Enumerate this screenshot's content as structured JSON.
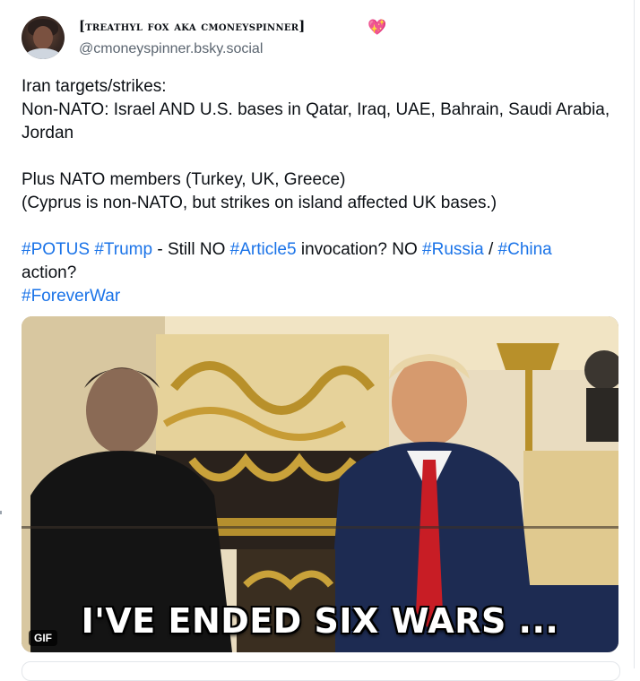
{
  "author": {
    "display_name": "[treathyl fox aka cmoneyspinner]",
    "badge_icon": "sparkling-heart-icon",
    "handle": "@cmoneyspinner.bsky.social"
  },
  "post": {
    "line1": "Iran targets/strikes:",
    "line2": "Non-NATO: Israel AND U.S. bases in Qatar, Iraq, UAE, Bahrain, Saudi Arabia, Jordan",
    "line3": "Plus NATO members (Turkey, UK, Greece)",
    "line4": "(Cyprus is non-NATO, but strikes on island affected UK bases.)",
    "tags": {
      "potus": "#POTUS",
      "trump": "#Trump",
      "article5": "#Article5",
      "russia": "#Russia",
      "china": "#China",
      "foreverwar": "#ForeverWar"
    },
    "segments": {
      "dash": " - Still NO ",
      "invocation": " invocation? NO ",
      "slash": " / ",
      "action": " action?"
    }
  },
  "media": {
    "badge": "GIF",
    "caption": "I'VE ENDED SIX WARS ..."
  },
  "colors": {
    "link": "#1a73e8",
    "handle": "#5b6570",
    "heart": "#e84a8a"
  }
}
